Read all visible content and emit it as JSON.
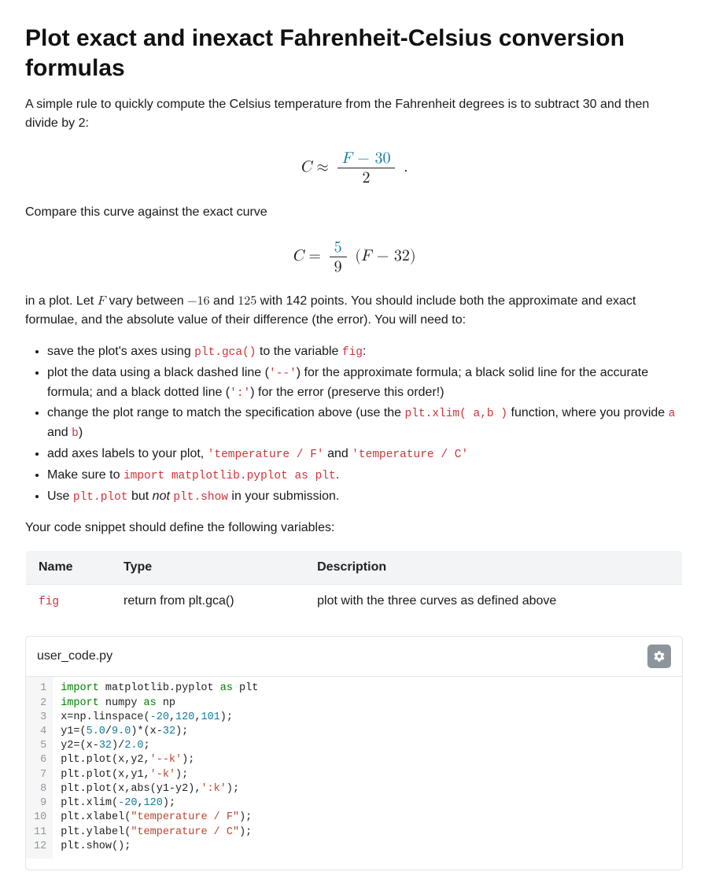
{
  "title": "Plot exact and inexact Fahrenheit-Celsius conversion formulas",
  "intro": "A simple rule to quickly compute the Celsius temperature from the Fahrenheit degrees is to subtract 30 and then divide by 2:",
  "compare_text": "Compare this curve against the exact curve",
  "plot_para_a": "in a plot. Let ",
  "plot_para_b": " vary between ",
  "plot_para_c": " and ",
  "plot_para_d": " with 142 points. You should include both the approximate and exact formulae, and the absolute value of their difference (the error). You will need to:",
  "F_sym": "F",
  "lo": "−16",
  "hi": "125",
  "bullets": {
    "b1a": "save the plot's axes using ",
    "b1b": " to the variable ",
    "b1c": ":",
    "code_gca": "plt.gca()",
    "code_fig": "fig",
    "b2a": "plot the data using a black dashed line (",
    "b2b": ") for the approximate formula; a black solid line for the accurate formula; and a black dotted line (",
    "b2c": ") for the error (preserve this order!)",
    "code_dash": "'--'",
    "code_dot": "':'",
    "b3a": "change the plot range to match the specification above (use the ",
    "b3b": " function, where you provide ",
    "b3c": " and ",
    "b3d": ")",
    "code_xlim": "plt.xlim( a,b )",
    "code_a": "a",
    "code_b": "b",
    "b4a": "add axes labels to your plot, ",
    "b4b": " and ",
    "code_xlab": "'temperature / F'",
    "code_ylab": "'temperature / C'",
    "b5a": "Make sure to ",
    "b5b": ".",
    "code_import": "import matplotlib.pyplot as plt",
    "b6a": "Use ",
    "b6b": " but ",
    "b6c": " in your submission.",
    "not": "not ",
    "code_plot": "plt.plot",
    "code_show": "plt.show"
  },
  "defines": "Your code snippet should define the following variables:",
  "table": {
    "h1": "Name",
    "h2": "Type",
    "h3": "Description",
    "r1c1": "fig",
    "r1c2": "return from plt.gca()",
    "r1c3": "plot with the three curves as defined above"
  },
  "filename": "user_code.py",
  "code_lines": [
    "import matplotlib.pyplot as plt",
    "import numpy as np",
    "x=np.linspace(-20,120,101);",
    "y1=(5.0/9.0)*(x-32);",
    "y2=(x-32)/2.0;",
    "plt.plot(x,y2,'--k');",
    "plt.plot(x,y1,'-k');",
    "plt.plot(x,abs(y1-y2),':k');",
    "plt.xlim(-20,120);",
    "plt.xlabel(\"temperature / F\");",
    "plt.ylabel(\"temperature / C\");",
    "plt.show();"
  ]
}
